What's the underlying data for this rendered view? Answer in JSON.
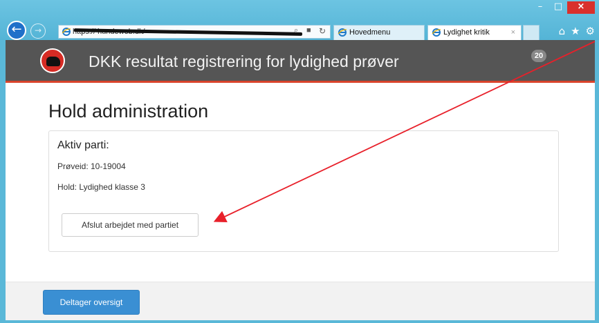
{
  "browser": {
    "window_controls": {
      "minimize": "–",
      "maximize": "□",
      "close": "×"
    },
    "back_icon": "back-arrow-icon",
    "forward_icon": "forward-arrow-icon",
    "address_bar": {
      "url_visible": "https://    hundeweb.dk/",
      "search_icon": "⌕",
      "lock_icon": "🔒",
      "refresh_icon": "↻"
    },
    "tabs": [
      {
        "label": "Hovedmenu",
        "active": false
      },
      {
        "label": "Lydighet kritik",
        "active": true,
        "close": "×"
      }
    ],
    "toolbar_icons": {
      "home": "⌂",
      "favorites": "★",
      "settings": "⚙"
    }
  },
  "navbar": {
    "brand": "DKK resultat registrering for lydighed prøver",
    "badge": "20",
    "colors": {
      "bar": "#555555",
      "accent_line": "#d9442b"
    }
  },
  "main": {
    "title": "Hold administration",
    "panel": {
      "heading": "Aktiv parti:",
      "proeveid": "Prøveid: 10-19004",
      "hold": "Hold: Lydighed klasse 3",
      "end_button": "Afslut arbejdet med partiet"
    }
  },
  "footer": {
    "participants_button": "Deltager oversigt",
    "colors": {
      "button": "#3a8fd3"
    }
  },
  "annotation": {
    "color": "#e8202a"
  }
}
